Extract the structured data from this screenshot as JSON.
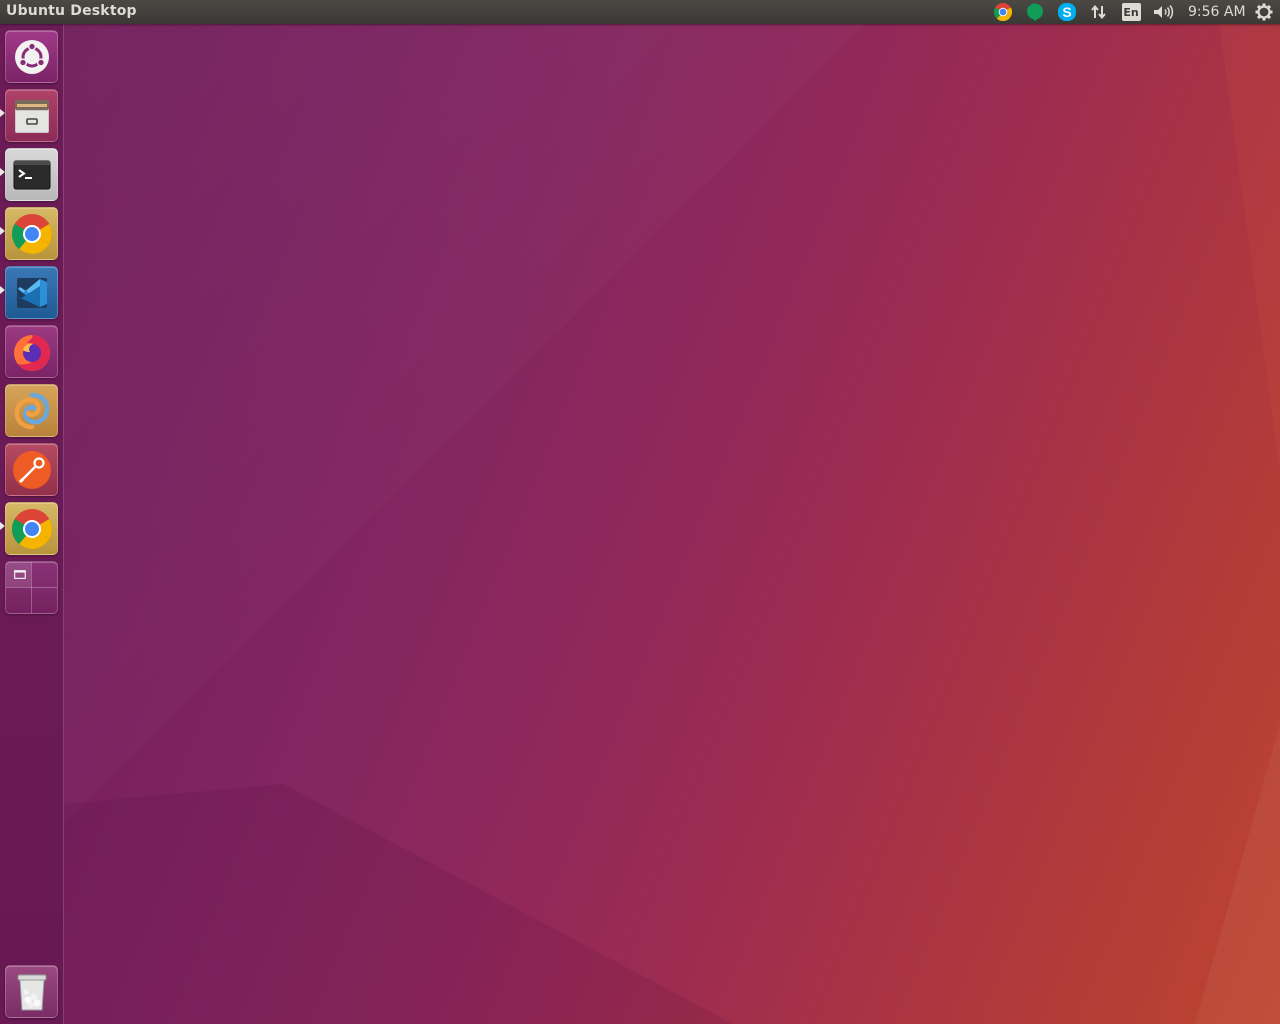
{
  "top_panel": {
    "window_title": "Ubuntu Desktop",
    "clock": "9:56 AM",
    "indicators": [
      "chrome-indicator-icon",
      "hangouts-indicator-icon",
      "skype-indicator-icon",
      "network-updown-icon",
      "keyboard-layout-icon",
      "volume-icon",
      "session-gear-icon"
    ],
    "keyboard_layout": "En"
  },
  "launcher": {
    "items": [
      {
        "name": "Ubuntu Dash",
        "icon": "ubuntu-logo-icon",
        "running": false
      },
      {
        "name": "Files",
        "icon": "file-cabinet-icon",
        "running": true
      },
      {
        "name": "Terminal",
        "icon": "terminal-icon",
        "running": true
      },
      {
        "name": "Google Chrome",
        "icon": "chrome-icon",
        "running": true
      },
      {
        "name": "Visual Studio Code",
        "icon": "vscode-icon",
        "running": true
      },
      {
        "name": "Firefox",
        "icon": "firefox-icon",
        "running": false
      },
      {
        "name": "Meld",
        "icon": "meld-icon",
        "running": false
      },
      {
        "name": "Postman",
        "icon": "postman-icon",
        "running": false
      },
      {
        "name": "Google Chrome",
        "icon": "chrome-icon",
        "running": true
      },
      {
        "name": "Workspace Switcher",
        "icon": "workspace-switcher-icon",
        "running": false
      },
      {
        "name": "Trash",
        "icon": "trash-icon",
        "running": false
      }
    ]
  },
  "colors": {
    "panel": "#3c3b37",
    "launcher": "#6a1a55",
    "wallpaper_left": "#6b1857",
    "wallpaper_right": "#bd452f"
  }
}
